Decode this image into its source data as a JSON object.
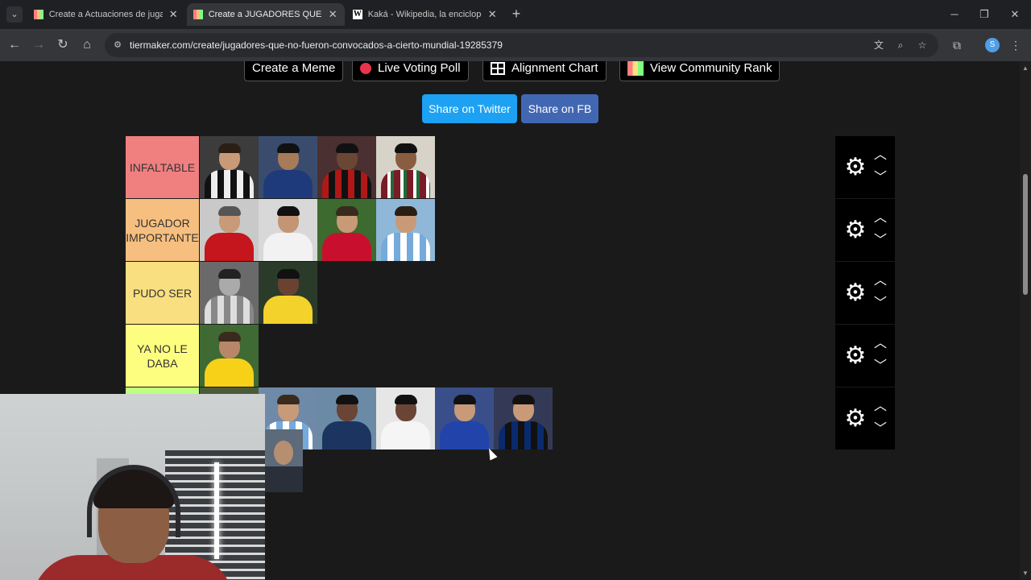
{
  "browser": {
    "tabs": [
      {
        "title": "Create a Actuaciones de jugado",
        "favicon": "tiermaker",
        "active": false
      },
      {
        "title": "Create a JUGADORES QUE NO F",
        "favicon": "tiermaker",
        "active": true
      },
      {
        "title": "Kaká - Wikipedia, la enciclopedi",
        "favicon": "wikipedia",
        "active": false
      }
    ],
    "url": "tiermaker.com/create/jugadores-que-no-fueron-convocados-a-cierto-mundial-19285379"
  },
  "page": {
    "top_buttons": [
      {
        "label": "Create a Meme",
        "icon": "none"
      },
      {
        "label": "Live Voting Poll",
        "icon": "red-dot-icon"
      },
      {
        "label": "Alignment Chart",
        "icon": "grid-icon"
      },
      {
        "label": "View Community Rank",
        "icon": "rank-grid-icon"
      }
    ],
    "share_twitter": "Share on Twitter",
    "share_fb": "Share on FB",
    "tiers": [
      {
        "label": "INFALTABLE",
        "color": "#f07f7f",
        "items": 4
      },
      {
        "label": "JUGADOR IMPORTANTE",
        "color": "#f7bf7f",
        "items": 4
      },
      {
        "label": "PUDO SER",
        "color": "#f9df7f",
        "items": 2
      },
      {
        "label": "YA NO LE DABA",
        "color": "#fdfd80",
        "items": 1
      },
      {
        "label": "",
        "color": "#bfff7f",
        "items": 6
      }
    ],
    "unranked_items": 1
  },
  "colors": {
    "background": "#1a1a1b",
    "control_panel": "#000000",
    "twitter": "#1da1f2",
    "facebook": "#4267b2"
  }
}
